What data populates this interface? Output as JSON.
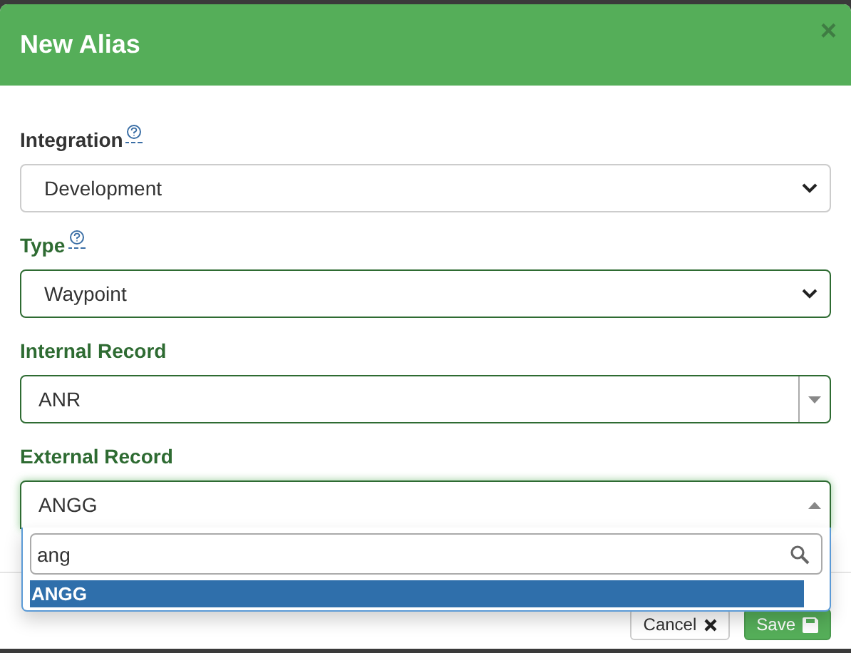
{
  "dialog": {
    "title": "New Alias",
    "close": "×"
  },
  "fields": [
    {
      "kind": "select",
      "label": "Integration",
      "help": true,
      "valid": false,
      "value": "Development"
    },
    {
      "kind": "select",
      "label": "Type",
      "help": true,
      "valid": true,
      "value": "Waypoint"
    },
    {
      "kind": "combo",
      "label": "Internal Record",
      "valid": true,
      "value": "ANR"
    },
    {
      "kind": "combo",
      "label": "External Record",
      "valid": true,
      "value": "ANGG",
      "open": true
    }
  ],
  "dropdown": {
    "search": "ang",
    "options": [
      {
        "label": "ANGG",
        "selected": true
      }
    ]
  },
  "buttons": [
    {
      "label": "Cancel",
      "kind": "default"
    },
    {
      "label": "Save",
      "kind": "primary"
    }
  ]
}
